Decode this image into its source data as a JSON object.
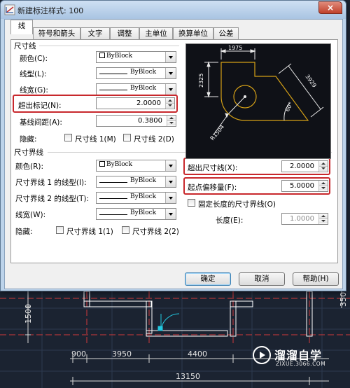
{
  "window": {
    "title": "新建标注样式: 100",
    "close_glyph": "×"
  },
  "tabs": [
    {
      "label": "线"
    },
    {
      "label": "符号和箭头"
    },
    {
      "label": "文字"
    },
    {
      "label": "调整"
    },
    {
      "label": "主单位"
    },
    {
      "label": "换算单位"
    },
    {
      "label": "公差"
    }
  ],
  "dim_lines": {
    "group": "尺寸线",
    "color_label": "颜色(C):",
    "color_value": "ByBlock",
    "linetype_label": "线型(L):",
    "linetype_value": "ByBlock",
    "lineweight_label": "线宽(G):",
    "lineweight_value": "ByBlock",
    "extend_ticks_label": "超出标记(N):",
    "extend_ticks_value": "2.0000",
    "baseline_label": "基线间距(A):",
    "baseline_value": "0.3800",
    "suppress_label": "隐藏:",
    "suppress_1": "尺寸线 1(M)",
    "suppress_2": "尺寸线 2(D)"
  },
  "ext_lines": {
    "group": "尺寸界线",
    "color_label": "颜色(R):",
    "color_value": "ByBlock",
    "linetype1_label": "尺寸界线 1 的线型(I):",
    "linetype1_value": "ByBlock",
    "linetype2_label": "尺寸界线 2 的线型(T):",
    "linetype2_value": "ByBlock",
    "lineweight_label": "线宽(W):",
    "lineweight_value": "ByBlock",
    "suppress_label": "隐藏:",
    "suppress_1": "尺寸界线 1(1)",
    "suppress_2": "尺寸界线 2(2)",
    "extend_label": "超出尺寸线(X):",
    "extend_value": "2.0000",
    "offset_label": "起点偏移量(F):",
    "offset_value": "5.0000",
    "fixed_label": "固定长度的尺寸界线(O)",
    "length_label": "长度(E):",
    "length_value": "1.0000"
  },
  "preview": {
    "dim_top": "1975",
    "dim_left": "2325",
    "dim_right": "3929",
    "dim_angle": "60°",
    "dim_radius": "R1504"
  },
  "buttons": {
    "ok": "确定",
    "cancel": "取消",
    "help": "帮助(H)"
  },
  "cad_background": {
    "dims": [
      "1500",
      "900",
      "3950",
      "4400",
      "13150",
      "350"
    ]
  },
  "watermark": {
    "title": "溜溜自学",
    "subtitle": "ZIXUE.3066.COM"
  },
  "colors": {
    "highlight": "#c8282c",
    "cad_bg": "#1b2331",
    "preview_line": "#d4a017"
  }
}
